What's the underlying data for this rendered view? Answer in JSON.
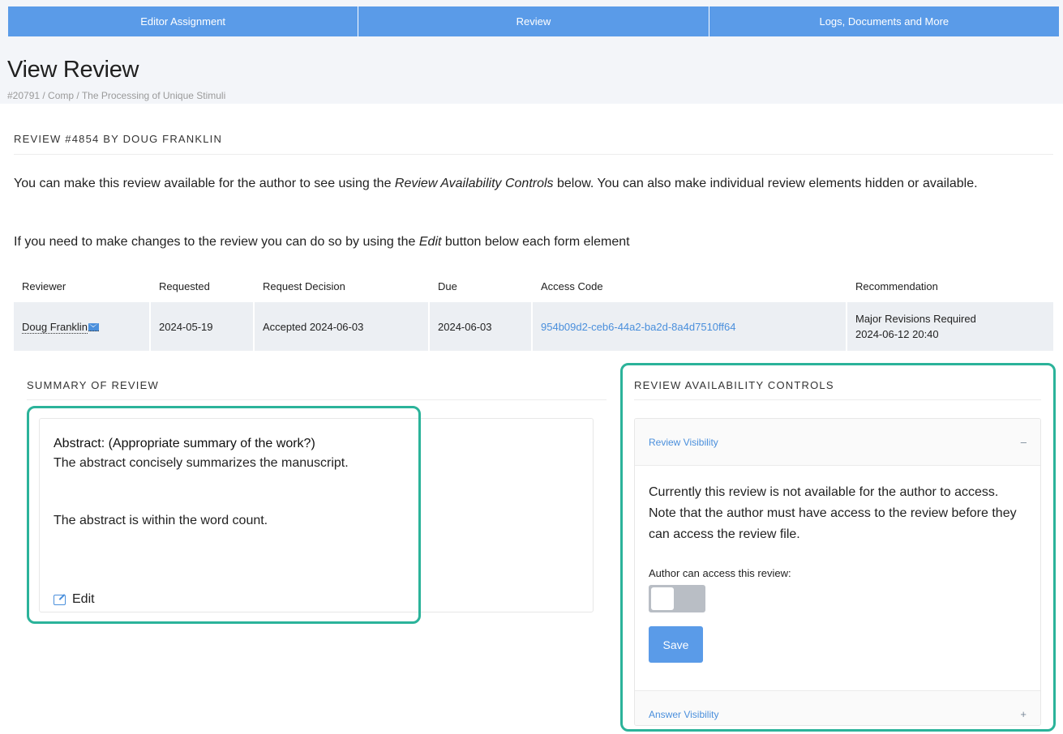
{
  "tabs": [
    {
      "label": "Editor Assignment"
    },
    {
      "label": "Review"
    },
    {
      "label": "Logs, Documents and More"
    }
  ],
  "page": {
    "title": "View Review",
    "breadcrumb": "#20791 / Comp / The Processing of Unique Stimuli"
  },
  "review": {
    "heading": "REVIEW #4854 BY DOUG FRANKLIN",
    "intro1_before": "You can make this review available for the author to see using the ",
    "intro1_em": "Review Availability Controls",
    "intro1_after": " below. You can also make individual review elements hidden or available.",
    "intro2_before": "If you need to make changes to the review you can do so by using the ",
    "intro2_em": "Edit",
    "intro2_after": " button below each form element"
  },
  "table": {
    "headers": {
      "reviewer": "Reviewer",
      "requested": "Requested",
      "request_decision": "Request Decision",
      "due": "Due",
      "access_code": "Access Code",
      "recommendation": "Recommendation"
    },
    "row": {
      "reviewer": "Doug Franklin",
      "requested": "2024-05-19",
      "request_decision": "Accepted 2024-06-03",
      "due": "2024-06-03",
      "access_code": "954b09d2-ceb6-44a2-ba2d-8a4d7510ff64",
      "recommendation_line1": "Major Revisions Required",
      "recommendation_line2": "2024-06-12 20:40"
    }
  },
  "summary": {
    "heading": "SUMMARY OF REVIEW",
    "question": "Abstract: (Appropriate summary of the work?)",
    "answer_line1": "The abstract concisely summarizes the manuscript.",
    "answer_line2": "The abstract is within the word count.",
    "edit_label": "Edit"
  },
  "availability": {
    "heading": "REVIEW AVAILABILITY CONTROLS",
    "review_visibility_label": "Review Visibility",
    "review_visibility_sign": "–",
    "status_text": "Currently this review is not available for the author to access. Note that the author must have access to the review before they can access the review file.",
    "toggle_label": "Author can access this review:",
    "toggle_on": false,
    "save_label": "Save",
    "answer_visibility_label": "Answer Visibility",
    "answer_visibility_sign": "+"
  }
}
